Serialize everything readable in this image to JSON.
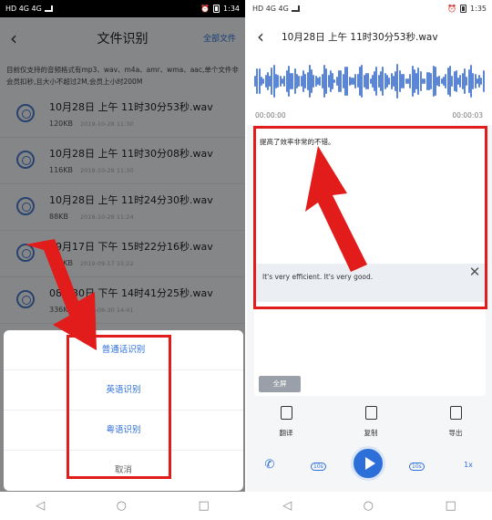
{
  "left": {
    "status": {
      "carrier": "HD 4G 4G",
      "time": "1:34"
    },
    "header": {
      "back": "‹",
      "title": "文件识别",
      "all_files": "全部文件"
    },
    "notice": "目前仅支持的音频格式有mp3、wav、m4a、amr、wma、aac,单个文件非会员扣秒,且大小不超过2M,会员上小时200M",
    "files": [
      {
        "name": "10月28日 上午 11时30分53秒.wav",
        "size": "120KB",
        "date": "2019-10-28 11:30"
      },
      {
        "name": "10月28日 上午 11时30分08秒.wav",
        "size": "116KB",
        "date": "2019-10-28 11:30"
      },
      {
        "name": "10月28日 上午 11时24分30秒.wav",
        "size": "88KB",
        "date": "2019-10-28 11:24"
      },
      {
        "name": "09月17日 下午 15时22分16秒.wav",
        "size": "108KB",
        "date": "2019-09-17 15:22"
      },
      {
        "name": "08月30日 下午 14时41分25秒.wav",
        "size": "336KB",
        "date": "2019-08-30 14:41"
      }
    ],
    "sheet": {
      "mandarin": "普通话识别",
      "english": "英语识别",
      "cantonese": "粤语识别",
      "cancel": "取消"
    },
    "nav": {
      "back": "◁",
      "home": "○",
      "recent": "□"
    }
  },
  "right": {
    "status": {
      "carrier": "HD 4G 4G",
      "time": "1:35"
    },
    "header": {
      "back": "‹",
      "title": "10月28日 上午 11时30分53秒.wav"
    },
    "time_start": "00:00:00",
    "time_end": "00:00:03",
    "transcript": "提高了效率非常的不错。",
    "translation": "It's very efficient. It's very good.",
    "close": "✕",
    "fullscreen": "全屏",
    "tools": {
      "translate": "翻译",
      "copy": "复制",
      "export": "导出"
    },
    "player": {
      "rewind": "10s",
      "forward": "10s",
      "speed": "1x"
    },
    "nav": {
      "back": "◁",
      "home": "○",
      "recent": "□"
    }
  },
  "colors": {
    "accent": "#2d6fd9",
    "annotation": "#e21b1b"
  }
}
